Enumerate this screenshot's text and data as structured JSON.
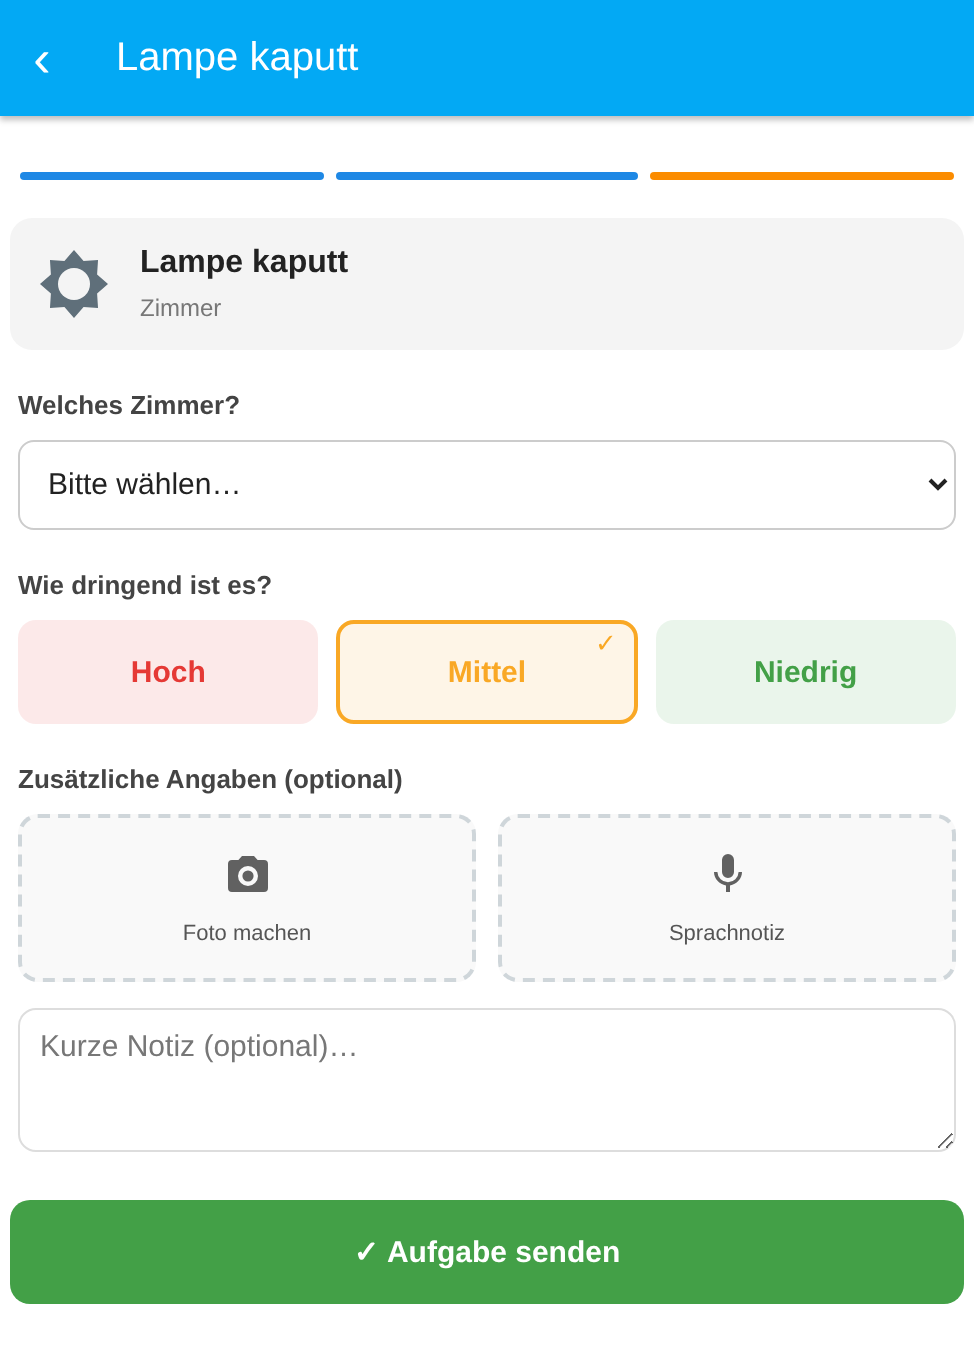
{
  "header": {
    "back": "‹",
    "title": "Lampe kaputt"
  },
  "steps": [
    {
      "color": "#1e88e5"
    },
    {
      "color": "#1e88e5"
    },
    {
      "color": "#fb8c00"
    }
  ],
  "task": {
    "title": "Lampe kaputt",
    "subtitle": "Zimmer"
  },
  "room": {
    "label": "Welches Zimmer?",
    "value": "Bitte wählen…"
  },
  "urgency": {
    "label": "Wie dringend ist es?",
    "selected_mark": "✓",
    "options": [
      {
        "label": "Hoch",
        "color": "#e53935",
        "selected": false
      },
      {
        "label": "Mittel",
        "color": "#f9a825",
        "selected": true
      },
      {
        "label": "Niedrig",
        "color": "#43a047",
        "selected": false
      }
    ]
  },
  "extras": {
    "label": "Zusätzliche Angaben (optional)",
    "items": [
      {
        "kind": "camera",
        "label": "Foto machen"
      },
      {
        "kind": "mic",
        "label": "Sprachnotiz"
      }
    ]
  },
  "note": {
    "placeholder": "Kurze Notiz (optional)…"
  },
  "submit": {
    "label": "✓ Aufgabe senden"
  }
}
